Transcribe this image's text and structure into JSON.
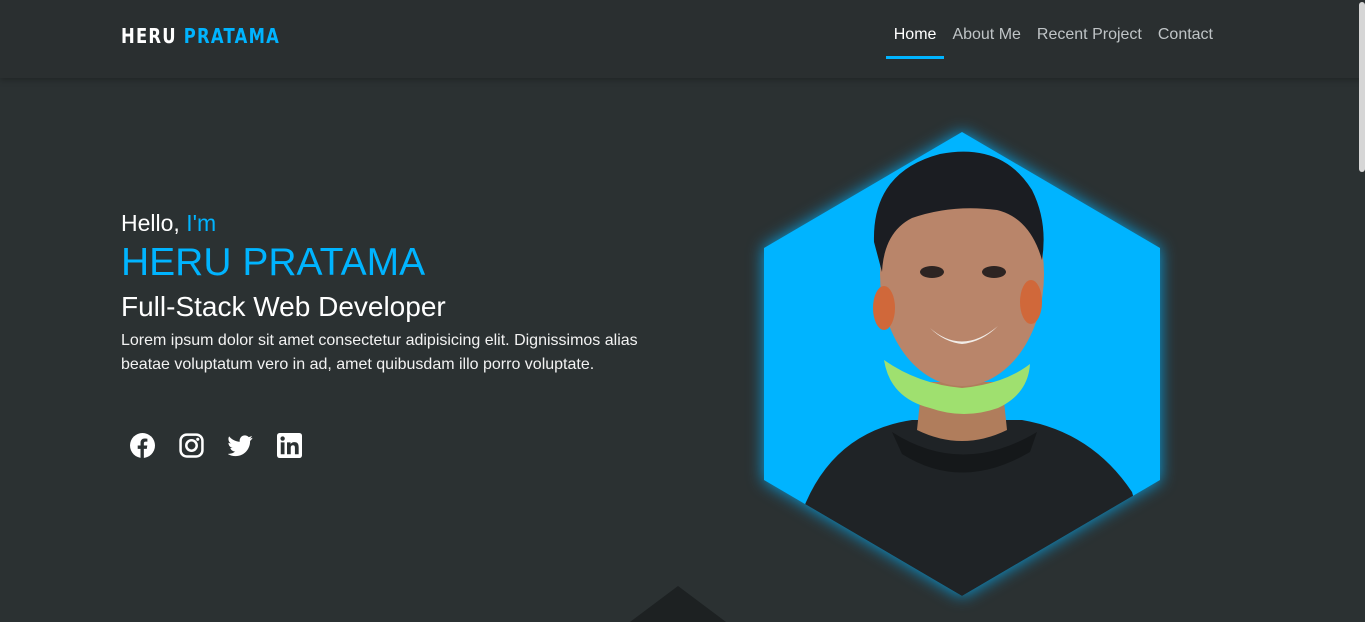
{
  "brand": {
    "first": "HERU",
    "last": "PRATAMA"
  },
  "nav": {
    "items": [
      {
        "label": "Home",
        "active": true
      },
      {
        "label": "About Me",
        "active": false
      },
      {
        "label": "Recent Project",
        "active": false
      },
      {
        "label": "Contact",
        "active": false
      }
    ]
  },
  "hero": {
    "greeting": "Hello,",
    "greeting_accent": "I'm",
    "name": "HERU PRATAMA",
    "role": "Full-Stack Web Developer",
    "description": "Lorem ipsum dolor sit amet consectetur adipisicing elit. Dignissimos alias beatae voluptatum vero in ad, amet quibusdam illo porro voluptate."
  },
  "social": [
    "facebook-icon",
    "instagram-icon",
    "twitter-icon",
    "linkedin-icon"
  ],
  "colors": {
    "accent": "#00b4ff",
    "background": "#2b3132",
    "navbar": "#2a2f30"
  }
}
